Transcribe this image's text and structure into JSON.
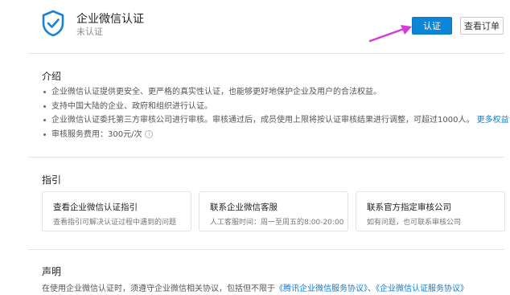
{
  "header": {
    "title": "企业微信认证",
    "status": "未认证",
    "verify_button": "认证",
    "orders_button": "查看订单"
  },
  "intro": {
    "heading": "介绍",
    "items": [
      "企业微信认证提供更安全、更严格的真实性认证，也能够更好地保护企业及用户的合法权益。",
      "支持中国大陆的企业、政府和组织进行认证。",
      "企业微信认证委托第三方审核公司进行审核。审核通过后，成员使用上限将按认证审核结果进行调整，可超过1000人。",
      "审核服务费用：300元/次"
    ],
    "more_link": "更多权益说明"
  },
  "guide": {
    "heading": "指引",
    "cards": [
      {
        "title": "查看企业微信认证指引",
        "desc": "查看指引可解决认证过程中遇到的问题"
      },
      {
        "title": "联系企业微信客服",
        "desc": "人工客服时间：周一至周五的8:00-20:00"
      },
      {
        "title": "联系官方指定审核公司",
        "desc": "如有问题，也可联系审核公司"
      }
    ]
  },
  "statement": {
    "heading": "声明",
    "text_prefix": "在使用企业微信认证时，须遵守企业微信相关协议，包括但不限于",
    "link1": "《腾讯企业微信服务协议》",
    "separator": "、",
    "link2": "《企业微信认证服务协议》"
  },
  "colors": {
    "primary": "#0e86d8",
    "link": "#0e7bd1",
    "annotation_arrow": "#d63bd8"
  },
  "icons": {
    "shield": "shield-check-icon",
    "info": "info-icon",
    "arrow": "annotation-arrow-icon"
  }
}
